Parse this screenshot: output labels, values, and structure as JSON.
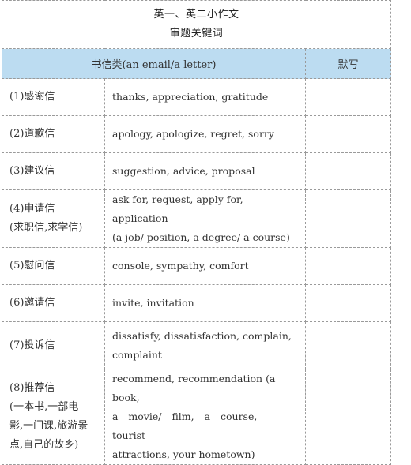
{
  "title": {
    "line1": "英一、英二小作文",
    "line2": "审题关键词"
  },
  "header": {
    "category": "书信类(an email/a letter)",
    "dictation": "默写"
  },
  "rows": [
    {
      "category": [
        "(1)感谢信"
      ],
      "keywords": [
        "thanks, appreciation, gratitude"
      ],
      "dictation": ""
    },
    {
      "category": [
        "(2)道歉信"
      ],
      "keywords": [
        "apology, apologize, regret, sorry"
      ],
      "dictation": ""
    },
    {
      "category": [
        "(3)建议信"
      ],
      "keywords": [
        "suggestion, advice, proposal"
      ],
      "dictation": ""
    },
    {
      "category": [
        "(4)申请信",
        "(求职信,求学信)"
      ],
      "keywords": [
        "ask for, request, apply for, application",
        "(a job/ position, a degree/ a course)"
      ],
      "dictation": ""
    },
    {
      "category": [
        "(5)慰问信"
      ],
      "keywords": [
        "console, sympathy, comfort"
      ],
      "dictation": ""
    },
    {
      "category": [
        "(6)邀请信"
      ],
      "keywords": [
        "invite, invitation"
      ],
      "dictation": ""
    },
    {
      "category": [
        "(7)投诉信"
      ],
      "keywords": [
        "dissatisfy, dissatisfaction, complain,",
        "complaint"
      ],
      "dictation": ""
    },
    {
      "category": [
        "(8)推荐信",
        "(一本书,一部电",
        "影,一门课,旅游景",
        "点,自己的故乡)"
      ],
      "keywords": [
        "recommend, recommendation (a book,",
        "a movie/ film, a course, tourist",
        "attractions, your hometown)"
      ],
      "dictation": ""
    }
  ]
}
